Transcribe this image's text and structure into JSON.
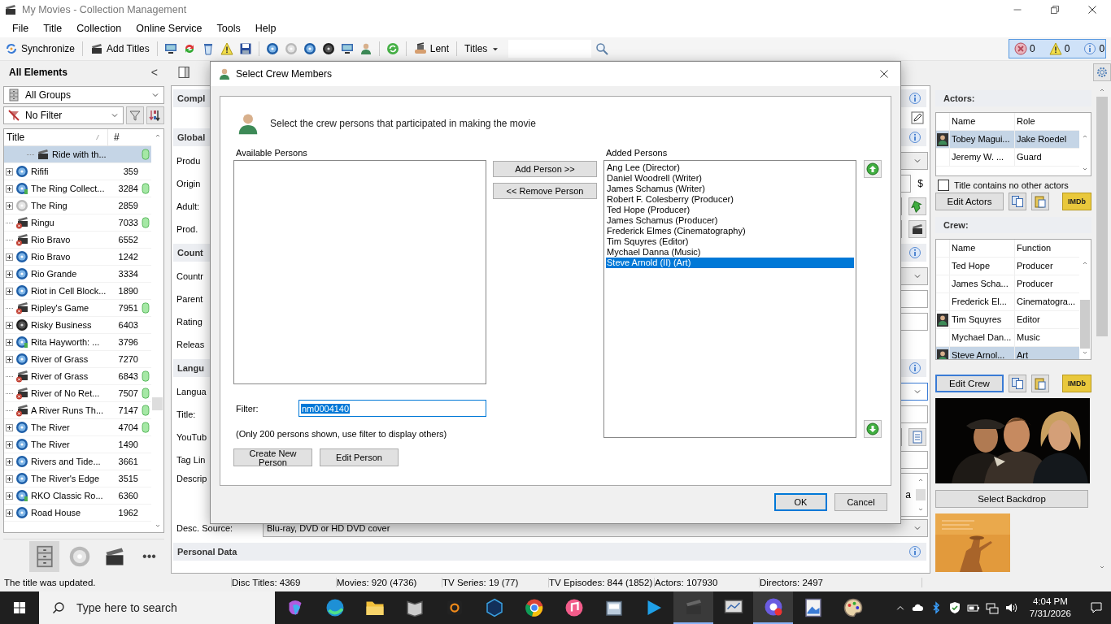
{
  "window": {
    "title": "My Movies - Collection Management"
  },
  "menu": [
    "File",
    "Title",
    "Collection",
    "Online Service",
    "Tools",
    "Help"
  ],
  "toolbar": {
    "synchronize": "Synchronize",
    "add_titles": "Add Titles",
    "lent": "Lent",
    "titles_dropdown": "Titles"
  },
  "counters": [
    {
      "kind": "error",
      "count": "0"
    },
    {
      "kind": "warning",
      "count": "0"
    },
    {
      "kind": "info",
      "count": "0"
    }
  ],
  "sidebar": {
    "title": "All Elements",
    "collapse": "<",
    "group": "All Groups",
    "filter": "No Filter",
    "columns": [
      "Title",
      "#"
    ],
    "rows": [
      {
        "children": [
          {
            "title": "Ride with th...",
            "kind": "clapper",
            "expandable": false,
            "flag": true,
            "selected": true
          }
        ]
      },
      {
        "title": "Rififi",
        "number": "359",
        "kind": "disc",
        "expandable": true,
        "flag": false,
        "selected": false
      },
      {
        "title": "The Ring Collect...",
        "number": "3284",
        "kind": "disc_set",
        "expandable": true,
        "flag": true,
        "selected": false
      },
      {
        "title": "The Ring",
        "number": "2859",
        "kind": "disc_silver",
        "expandable": true,
        "flag": false,
        "selected": false
      },
      {
        "title": "Ringu",
        "number": "7033",
        "kind": "clapper_missing",
        "expandable": false,
        "flag": true,
        "selected": false
      },
      {
        "title": "Rio Bravo",
        "number": "6552",
        "kind": "clapper_missing",
        "expandable": false,
        "flag": false,
        "selected": false
      },
      {
        "title": "Rio Bravo",
        "number": "1242",
        "kind": "disc",
        "expandable": true,
        "flag": false,
        "selected": false
      },
      {
        "title": "Rio Grande",
        "number": "3334",
        "kind": "disc",
        "expandable": true,
        "flag": false,
        "selected": false
      },
      {
        "title": "Riot in Cell Block...",
        "number": "1890",
        "kind": "disc",
        "expandable": true,
        "flag": false,
        "selected": false
      },
      {
        "title": "Ripley's Game",
        "number": "7951",
        "kind": "clapper_missing",
        "expandable": false,
        "flag": true,
        "selected": false
      },
      {
        "title": "Risky Business",
        "number": "6403",
        "kind": "disc_dark",
        "expandable": true,
        "flag": false,
        "selected": false
      },
      {
        "title": "Rita Hayworth: ...",
        "number": "3796",
        "kind": "disc_set",
        "expandable": true,
        "flag": false,
        "selected": false
      },
      {
        "title": "River of Grass",
        "number": "7270",
        "kind": "disc",
        "expandable": true,
        "flag": false,
        "selected": false
      },
      {
        "title": "River of Grass",
        "number": "6843",
        "kind": "clapper_missing",
        "expandable": false,
        "flag": true,
        "selected": false
      },
      {
        "title": "River of No Ret...",
        "number": "7507",
        "kind": "clapper_missing",
        "expandable": false,
        "flag": true,
        "selected": false
      },
      {
        "title": "A River Runs Th...",
        "number": "7147",
        "kind": "clapper_missing",
        "expandable": false,
        "flag": true,
        "selected": false
      },
      {
        "title": "The River",
        "number": "4704",
        "kind": "disc",
        "expandable": true,
        "flag": true,
        "selected": false
      },
      {
        "title": "The River",
        "number": "1490",
        "kind": "disc",
        "expandable": true,
        "flag": false,
        "selected": false
      },
      {
        "title": "Rivers and Tide...",
        "number": "3661",
        "kind": "disc",
        "expandable": true,
        "flag": false,
        "selected": false
      },
      {
        "title": "The River's Edge",
        "number": "3515",
        "kind": "disc",
        "expandable": true,
        "flag": false,
        "selected": false
      },
      {
        "title": "RKO Classic Ro...",
        "number": "6360",
        "kind": "disc_set",
        "expandable": true,
        "flag": false,
        "selected": false
      },
      {
        "title": "Road House",
        "number": "1962",
        "kind": "disc",
        "expandable": true,
        "flag": false,
        "selected": false
      }
    ],
    "views": [
      {
        "kind": "cabinet",
        "selected": true
      },
      {
        "kind": "disc",
        "selected": false
      },
      {
        "kind": "clapper",
        "selected": false
      },
      {
        "kind": "more",
        "label": "•••",
        "selected": false
      }
    ]
  },
  "details": [
    {
      "kind": "section",
      "label": "Compl"
    },
    {
      "kind": "edit_row"
    },
    {
      "kind": "section",
      "label": "Global"
    },
    {
      "kind": "dropdown",
      "label": "Produ",
      "focused": false
    },
    {
      "kind": "text",
      "label": "Origin",
      "suffix": "$"
    },
    {
      "kind": "arrow_button",
      "label": "Adult:"
    },
    {
      "kind": "clapper_button",
      "label": "Prod."
    },
    {
      "kind": "section",
      "label": "Count"
    },
    {
      "kind": "dropdown",
      "label": "Countr",
      "focused": false
    },
    {
      "kind": "text",
      "label": "Parent"
    },
    {
      "kind": "text",
      "label": "Rating"
    },
    {
      "kind": "plain",
      "label": "Releas"
    },
    {
      "kind": "section",
      "label": "Langu"
    },
    {
      "kind": "dropdown",
      "label": "Langua",
      "focused": true
    },
    {
      "kind": "text",
      "label": "Title:"
    },
    {
      "kind": "document_button",
      "label": "YouTub"
    },
    {
      "kind": "text",
      "label": "Tag Lin"
    },
    {
      "kind": "textarea",
      "label": "Descrip",
      "value": "a"
    },
    {
      "kind": "dropdown",
      "label": "Desc. Source:",
      "value": "Blu-ray, DVD or HD DVD cover",
      "focused": false
    },
    {
      "kind": "section",
      "label": "Personal Data"
    }
  ],
  "actors": {
    "title": "Actors:",
    "columns": [
      "Name",
      "Role"
    ],
    "rows": [
      {
        "name": "Tobey Magui...",
        "role": "Jake Roedel",
        "photo": true,
        "selected": true
      },
      {
        "name": "Jeremy W. ...",
        "role": "Guard",
        "photo": false,
        "selected": false
      }
    ],
    "no_other_actors": {
      "label": "Title contains no other actors",
      "checked": false
    },
    "edit_button": "Edit Actors",
    "imdb": "IMDb"
  },
  "crew": {
    "title": "Crew:",
    "columns": [
      "Name",
      "Function"
    ],
    "rows": [
      {
        "name": "Ted Hope",
        "function": "Producer",
        "photo": false,
        "selected": false
      },
      {
        "name": "James Scha...",
        "function": "Producer",
        "photo": false,
        "selected": false
      },
      {
        "name": "Frederick El...",
        "function": "Cinematogra...",
        "photo": false,
        "selected": false
      },
      {
        "name": "Tim Squyres",
        "function": "Editor",
        "photo": true,
        "selected": false
      },
      {
        "name": "Mychael Dan...",
        "function": "Music",
        "photo": false,
        "selected": false
      },
      {
        "name": "Steve Arnol...",
        "function": "Art",
        "photo": true,
        "selected": true
      }
    ],
    "edit_button": "Edit Crew",
    "imdb": "IMDb",
    "backdrop_button": "Select Backdrop"
  },
  "dialog": {
    "title": "Select Crew Members",
    "intro": "Select the crew persons that participated in making the movie",
    "available_label": "Available Persons",
    "added_label": "Added Persons",
    "add_button": "Add Person >>",
    "remove_button": "<< Remove Person",
    "added": [
      {
        "name": "Ang Lee (Director)",
        "selected": false
      },
      {
        "name": "Daniel Woodrell (Writer)",
        "selected": false
      },
      {
        "name": "James Schamus (Writer)",
        "selected": false
      },
      {
        "name": "Robert F. Colesberry (Producer)",
        "selected": false
      },
      {
        "name": "Ted Hope (Producer)",
        "selected": false
      },
      {
        "name": "James Schamus (Producer)",
        "selected": false
      },
      {
        "name": "Frederick Elmes (Cinematography)",
        "selected": false
      },
      {
        "name": "Tim Squyres (Editor)",
        "selected": false
      },
      {
        "name": "Mychael Danna (Music)",
        "selected": false
      },
      {
        "name": "Steve Arnold (II) (Art)",
        "selected": true
      }
    ],
    "filter_label": "Filter:",
    "filter_value": "nm0004140",
    "note": "(Only 200 persons shown, use filter to display others)",
    "create_button": "Create New Person",
    "edit_button": "Edit Person",
    "ok": "OK",
    "cancel": "Cancel"
  },
  "status_bar": [
    "The title was updated.",
    "Disc Titles: 4369",
    "Movies: 920 (4736)",
    "TV Series: 19 (77)",
    "TV Episodes: 844 (1852)",
    "Actors: 107930",
    "Directors: 2497"
  ],
  "taskbar": {
    "search_placeholder": "Type here to search",
    "apps": [
      {
        "kind": "swirl",
        "active": false
      },
      {
        "kind": "globe",
        "active": false
      },
      {
        "kind": "folder",
        "active": false
      },
      {
        "kind": "book",
        "active": false
      },
      {
        "kind": "speaker",
        "active": false
      },
      {
        "kind": "hexagon",
        "active": false
      },
      {
        "kind": "chrome",
        "active": false
      },
      {
        "kind": "music",
        "active": false
      },
      {
        "kind": "scanner",
        "active": false
      },
      {
        "kind": "play",
        "active": false
      },
      {
        "kind": "clapper",
        "active": true
      },
      {
        "kind": "monitor",
        "active": false
      },
      {
        "kind": "camera",
        "active": true
      },
      {
        "kind": "picture",
        "active": false
      },
      {
        "kind": "palette",
        "active": false
      }
    ],
    "time": "4:04 PM",
    "date": "7/31/2026"
  }
}
